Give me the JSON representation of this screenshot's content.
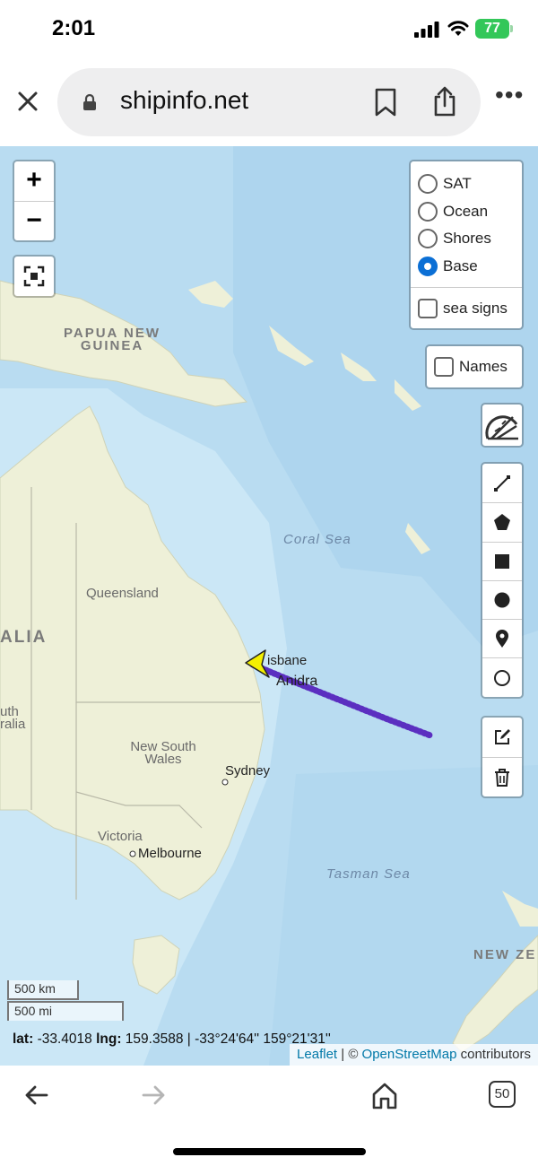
{
  "status_bar": {
    "time": "2:01",
    "battery": "77"
  },
  "browser": {
    "url": "shipinfo.net",
    "tab_count": "50"
  },
  "map": {
    "labels": {
      "png": "PAPUA NEW\nGUINEA",
      "aus": "ALIA",
      "aus2": "uth\nralia",
      "queensland": "Queensland",
      "nsw": "New South\nWales",
      "victoria": "Victoria",
      "coral_sea": "Coral Sea",
      "tasman_sea": "Tasman Sea",
      "nz": "NEW ZE",
      "brisbane": "isbane",
      "sydney": "Sydney",
      "melbourne": "Melbourne",
      "vessel": "Anidra"
    },
    "layers": {
      "options": [
        "SAT",
        "Ocean",
        "Shores",
        "Base"
      ],
      "selected": "Base",
      "sea_signs_label": "sea signs",
      "names_label": "Names"
    },
    "zoom_in": "+",
    "zoom_out": "−",
    "scale_km": "500 km",
    "scale_mi": "500 mi",
    "coords": {
      "lat_label": "lat:",
      "lat": "-33.4018",
      "lng_label": "lng:",
      "lng": "159.3588",
      "dms": "| -33°24'64'' 159°21'31''"
    },
    "attribution": {
      "leaflet": "Leaflet",
      "sep": " | © ",
      "osm": "OpenStreetMap",
      "suffix": " contributors"
    },
    "colors": {
      "ocean": "#b8dcf2",
      "land": "#eef0d8",
      "track": "#5b2fc0",
      "vessel": "#f4f000",
      "radio_on": "#0b6fd5"
    }
  }
}
